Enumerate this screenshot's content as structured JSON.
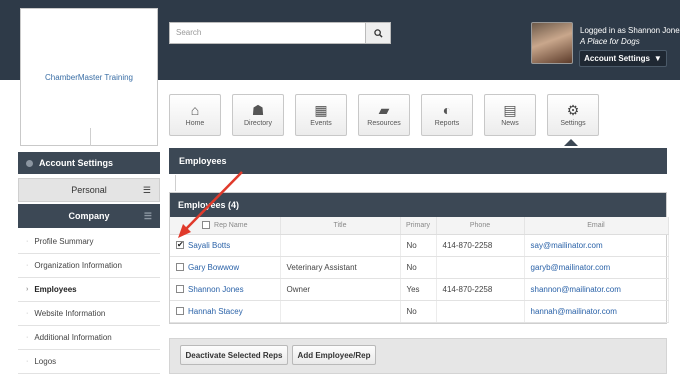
{
  "header": {
    "org_name": "ChamberMaster Training",
    "search": {
      "placeholder": "Search"
    },
    "user": {
      "logged_in_label": "Logged in as Shannon Jones",
      "organization": "A Place for Dogs",
      "account_button": "Account Settings"
    }
  },
  "nav": {
    "tiles": [
      {
        "label": "Home",
        "icon": "home-icon"
      },
      {
        "label": "Directory",
        "icon": "directory-icon"
      },
      {
        "label": "Events",
        "icon": "calendar-icon"
      },
      {
        "label": "Resources",
        "icon": "folder-icon"
      },
      {
        "label": "Reports",
        "icon": "chart-icon"
      },
      {
        "label": "News",
        "icon": "news-icon"
      },
      {
        "label": "Settings",
        "icon": "gear-icon"
      }
    ],
    "active": "Settings"
  },
  "sidebar": {
    "section_title": "Account Settings",
    "personal": "Personal",
    "company": "Company",
    "items": [
      "Profile Summary",
      "Organization Information",
      "Employees",
      "Website Information",
      "Additional Information",
      "Logos"
    ],
    "current_item": "Employees"
  },
  "main": {
    "panel_title": "Employees",
    "table_title": "Employees (4)",
    "columns": [
      "Rep Name",
      "Title",
      "Primary",
      "Phone",
      "Email"
    ],
    "rows": [
      {
        "name": "Sayali Botts",
        "title": "",
        "primary": "No",
        "phone": "414-870-2258",
        "email": "say@mailinator.com",
        "checked": true
      },
      {
        "name": "Gary Bowwow",
        "title": "Veterinary Assistant",
        "primary": "No",
        "phone": "",
        "email": "garyb@mailinator.com",
        "checked": false
      },
      {
        "name": "Shannon Jones",
        "title": "Owner",
        "primary": "Yes",
        "phone": "414-870-2258",
        "email": "shannon@mailinator.com",
        "checked": false
      },
      {
        "name": "Hannah Stacey",
        "title": "",
        "primary": "No",
        "phone": "",
        "email": "hannah@mailinator.com",
        "checked": false
      }
    ],
    "buttons": {
      "deactivate": "Deactivate Selected Reps",
      "add": "Add Employee/Rep"
    }
  },
  "colors": {
    "dark_bar": "#3c4855",
    "top_bar": "#2e3a48",
    "link": "#2a62a8",
    "annotation_arrow": "#e03a2b"
  }
}
